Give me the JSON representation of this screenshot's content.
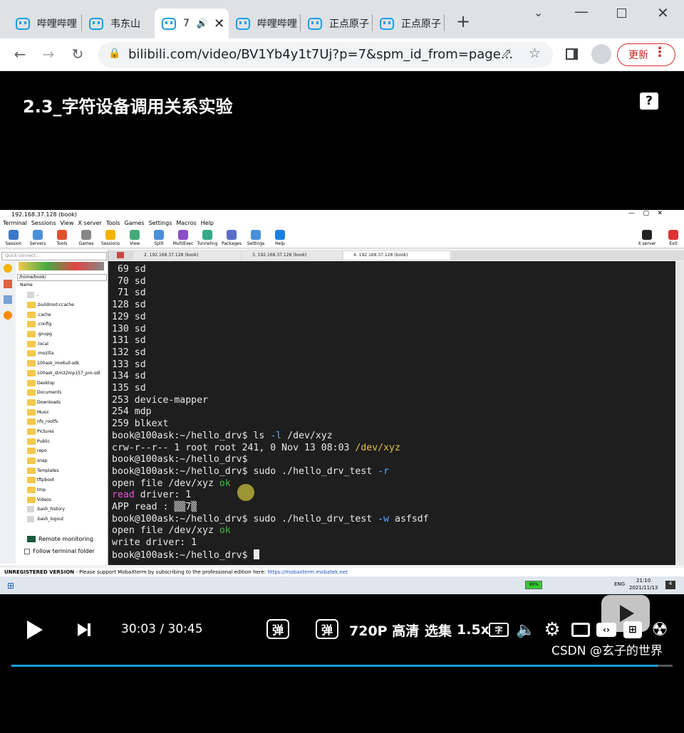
{
  "tabs": [
    {
      "label": "哔哩哔哩"
    },
    {
      "label": "韦东山"
    },
    {
      "label": "7"
    },
    {
      "label": "哔哩哔哩"
    },
    {
      "label": "正点原子"
    },
    {
      "label": "正点原子"
    }
  ],
  "address": {
    "url": "bilibili.com/video/BV1Yb4y1t7Uj?p=7&spm_id_from=page...",
    "update_label": "更新"
  },
  "video": {
    "title": "2.3_字符设备调用关系实验",
    "current_time": "30:03",
    "separator": "/",
    "duration": "30:45",
    "quality": "720P 高清",
    "episodes": "选集",
    "speed": "1.5x",
    "progress": 0.977,
    "watermark": "CSDN @玄子的世界"
  },
  "moba": {
    "window_title": "192.168.37.128 (book)",
    "menu": [
      "Terminal",
      "Sessions",
      "View",
      "X server",
      "Tools",
      "Games",
      "Settings",
      "Macros",
      "Help"
    ],
    "toolbar": [
      "Session",
      "Servers",
      "Tools",
      "Games",
      "Sessions",
      "View",
      "Split",
      "MultiExec",
      "Tunneling",
      "Packages",
      "Settings",
      "Help"
    ],
    "xserver": "X server",
    "exit": "Exit",
    "tabs": [
      "2. 192.168.37.128 (book)",
      "3. 192.168.37.128 (book)",
      "4. 192.168.37.128 (book)"
    ],
    "quick_connect": "Quick connect...",
    "path": "/home/book/",
    "name_header": "Name",
    "files": [
      "..",
      ".buildroot-ccache",
      ".cache",
      ".config",
      ".gnupg",
      ".local",
      ".mozilla",
      "100ask_imx6ull-sdk",
      "100ask_stm32mp157_pro-sdk",
      "Desktop",
      "Documents",
      "Downloads",
      "Music",
      "nfs_rootfs",
      "Pictures",
      "Public",
      "repo",
      "snap",
      "Templates",
      "tftpboot",
      "tmp",
      "Videos",
      ".bash_history",
      ".bash_logout"
    ],
    "remote_monitoring": "Remote monitoring",
    "follow_folder": "Follow terminal folder",
    "status_prefix": "UNREGISTERED VERSION",
    "status_text": " -  Please support MobaXterm by subscribing to the professional edition here:  ",
    "status_link": "https://mobaxterm.mobatek.net",
    "clock": "21:10",
    "date": "2021/11/13",
    "lang": "ENG",
    "battery": "99%",
    "notif": "4"
  },
  "terminal": [
    [
      {
        "t": " 69 sd"
      }
    ],
    [
      {
        "t": " 70 sd"
      }
    ],
    [
      {
        "t": " 71 sd"
      }
    ],
    [
      {
        "t": "128 sd"
      }
    ],
    [
      {
        "t": "129 sd"
      }
    ],
    [
      {
        "t": "130 sd"
      }
    ],
    [
      {
        "t": "131 sd"
      }
    ],
    [
      {
        "t": "132 sd"
      }
    ],
    [
      {
        "t": "133 sd"
      }
    ],
    [
      {
        "t": "134 sd"
      }
    ],
    [
      {
        "t": "135 sd"
      }
    ],
    [
      {
        "t": "253 device-mapper"
      }
    ],
    [
      {
        "t": "254 mdp"
      }
    ],
    [
      {
        "t": "259 blkext"
      }
    ],
    [
      {
        "t": "book@100ask:~/hello_drv$ ls "
      },
      {
        "t": "-l",
        "c": "b"
      },
      {
        "t": " /dev/xyz"
      }
    ],
    [
      {
        "t": "crw-r--r-- 1 root root 241, 0 Nov 13 08:03 "
      },
      {
        "t": "/dev/xyz",
        "c": "y"
      }
    ],
    [
      {
        "t": "book@100ask:~/hello_drv$"
      }
    ],
    [
      {
        "t": "book@100ask:~/hello_drv$ sudo ./hello_drv_test "
      },
      {
        "t": "-r",
        "c": "b"
      }
    ],
    [
      {
        "t": "open file /dev/xyz "
      },
      {
        "t": "ok",
        "c": "g"
      }
    ],
    [
      {
        "t": "read",
        "c": "m"
      },
      {
        "t": " driver: 1"
      }
    ],
    [
      {
        "t": "APP read : ▒▒7▒"
      }
    ],
    [
      {
        "t": "book@100ask:~/hello_drv$ sudo ./hello_drv_test "
      },
      {
        "t": "-w",
        "c": "b"
      },
      {
        "t": " asfsdf"
      }
    ],
    [
      {
        "t": "open file /dev/xyz "
      },
      {
        "t": "ok",
        "c": "g"
      }
    ],
    [
      {
        "t": "write driver: 1"
      }
    ],
    [
      {
        "t": "book@100ask:~/hello_drv$ "
      },
      {
        "t": "",
        "c": "cursor"
      }
    ]
  ]
}
